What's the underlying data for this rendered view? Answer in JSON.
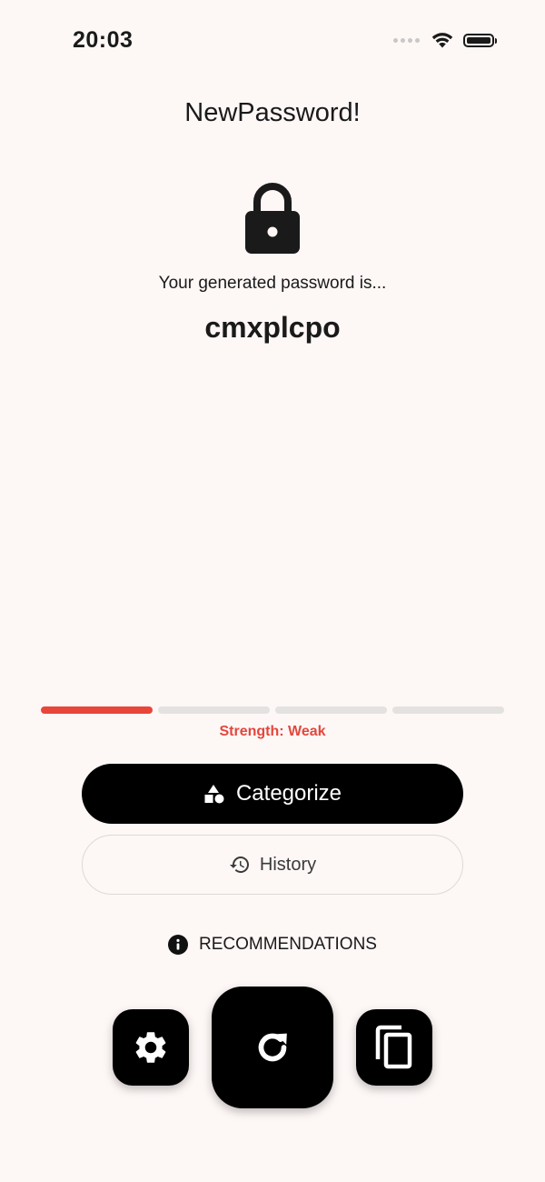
{
  "status_bar": {
    "time": "20:03"
  },
  "app": {
    "title": "NewPassword!"
  },
  "main": {
    "subtitle": "Your generated password is...",
    "password": "cmxplcpo",
    "lock_icon": "lock-icon"
  },
  "strength": {
    "label": "Strength: Weak",
    "level": 1,
    "segments": 4,
    "active_color": "#e8463b",
    "inactive_color": "#e4e2e1"
  },
  "buttons": {
    "categorize_label": "Categorize",
    "categorize_icon": "shapes-icon",
    "history_label": "History",
    "history_icon": "history-icon"
  },
  "recommendations": {
    "label": "RECOMMENDATIONS",
    "icon": "info-icon"
  },
  "actions": {
    "settings_icon": "gear-icon",
    "refresh_icon": "refresh-icon",
    "copy_icon": "copy-icon"
  }
}
